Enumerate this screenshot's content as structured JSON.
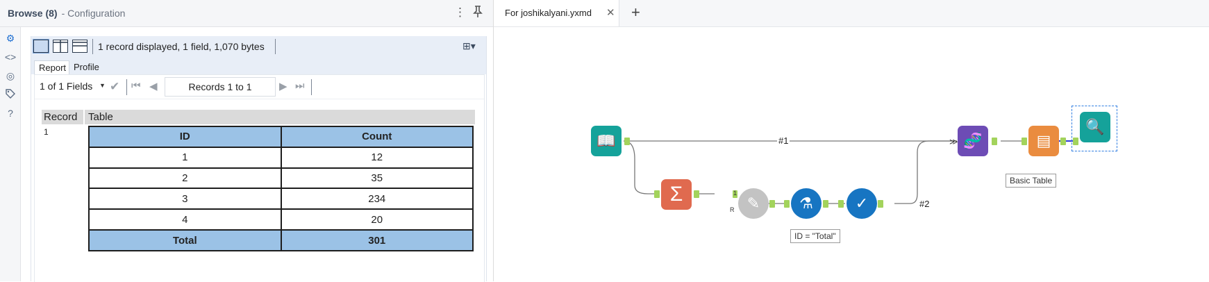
{
  "config_pane": {
    "title": "Browse (8)",
    "subtitle": "- Configuration",
    "menu_icon": "vertical-dots-icon",
    "pin_icon": "pin-icon",
    "rail_icons": [
      "gear-icon",
      "code-icon",
      "question-circle-icon",
      "tag-icon",
      "help-icon"
    ]
  },
  "browse": {
    "summary": "1 record displayed, 1 field, 1,070 bytes",
    "tabs": [
      {
        "label": "Report"
      },
      {
        "label": "Profile"
      }
    ],
    "fields_select": "1 of 1 Fields",
    "records_range": "Records 1 to 1",
    "grid_headers": [
      "Record",
      "Table"
    ],
    "row_number": "1",
    "report_table": {
      "headers": [
        "ID",
        "Count"
      ],
      "rows": [
        [
          "1",
          "12"
        ],
        [
          "2",
          "35"
        ],
        [
          "3",
          "234"
        ],
        [
          "4",
          "20"
        ]
      ],
      "total": [
        "Total",
        "301"
      ]
    }
  },
  "workflow": {
    "tab_label": "For joshikalyani.yxmd",
    "close_icon": "close-icon",
    "new_tab_icon": "plus-icon",
    "connection_labels": [
      "#1",
      "#2"
    ],
    "annotations": {
      "formula": "ID = \"Total\"",
      "table": "Basic Table"
    },
    "badge": "1",
    "tools": [
      {
        "name": "input-book-tool",
        "color": "#15a29a"
      },
      {
        "name": "summarize-tool",
        "color": "#e06a4f"
      },
      {
        "name": "dynamic-rename-tool",
        "color": "#c3c3c3"
      },
      {
        "name": "formula-tool",
        "color": "#1775c2"
      },
      {
        "name": "select-tool",
        "color": "#1775c2"
      },
      {
        "name": "union-tool",
        "color": "#6d4cb5"
      },
      {
        "name": "table-tool",
        "color": "#ea8c3f"
      },
      {
        "name": "browse-tool",
        "color": "#15a29a"
      }
    ]
  }
}
